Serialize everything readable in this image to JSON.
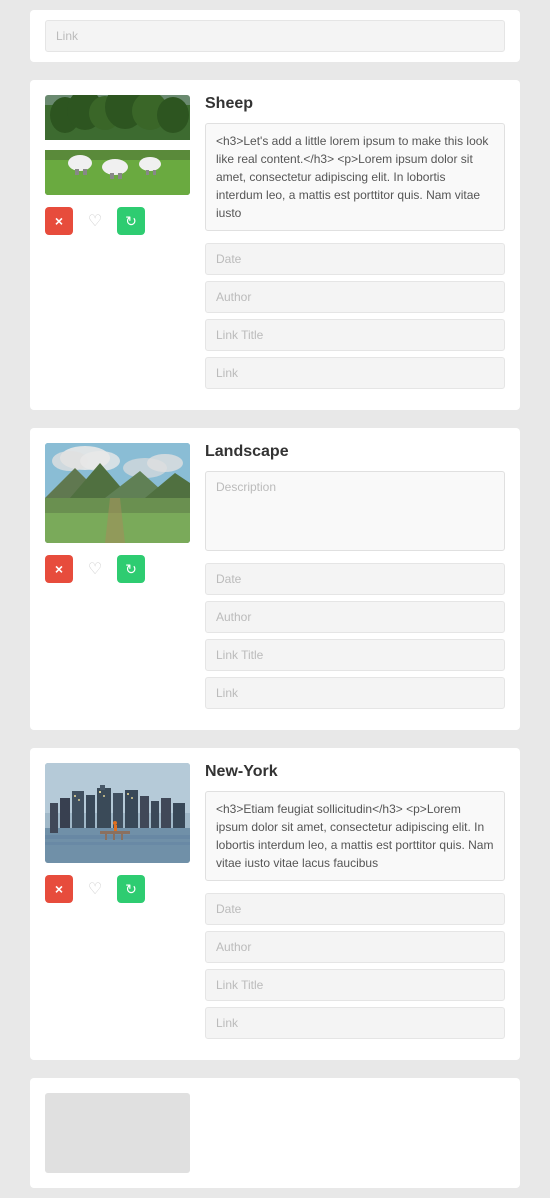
{
  "cards": [
    {
      "id": "top-partial",
      "type": "partial-top",
      "fields": [
        "Link"
      ]
    },
    {
      "id": "sheep",
      "type": "full",
      "title": "Sheep",
      "image_type": "sheep",
      "description": "<h3>Let's add a little lorem ipsum to make this look like real content.</h3> <p>Lorem ipsum dolor sit amet, consectetur adipiscing elit. In lobortis interdum leo, a mattis est porttitor quis. Nam vitae iusto",
      "fields": [
        "Date",
        "Author",
        "Link Title",
        "Link"
      ],
      "actions": {
        "delete": "×",
        "favorite": "♡",
        "refresh": "↻"
      }
    },
    {
      "id": "landscape",
      "type": "full",
      "title": "Landscape",
      "image_type": "landscape",
      "description_placeholder": "Description",
      "fields": [
        "Date",
        "Author",
        "Link Title",
        "Link"
      ],
      "actions": {
        "delete": "×",
        "favorite": "♡",
        "refresh": "↻"
      }
    },
    {
      "id": "newyork",
      "type": "full",
      "title": "New-York",
      "image_type": "newyork",
      "description": "<h3>Etiam feugiat sollicitudin</h3> <p>Lorem ipsum dolor sit amet, consectetur adipiscing elit. In lobortis interdum leo, a mattis est porttitor quis. Nam vitae iusto vitae lacus faucibus",
      "fields": [
        "Date",
        "Author",
        "Link Title",
        "Link"
      ],
      "actions": {
        "delete": "×",
        "favorite": "♡",
        "refresh": "↻"
      }
    },
    {
      "id": "bottom-partial",
      "type": "partial-bottom"
    }
  ],
  "labels": {
    "delete": "×",
    "favorite": "♡",
    "refresh": "↻",
    "link": "Link",
    "date": "Date",
    "author": "Author",
    "link_title": "Link Title",
    "description": "Description"
  },
  "colors": {
    "delete_btn": "#e74c3c",
    "refresh_btn": "#2ecc71",
    "favorite_btn_inactive": "#cccccc"
  }
}
